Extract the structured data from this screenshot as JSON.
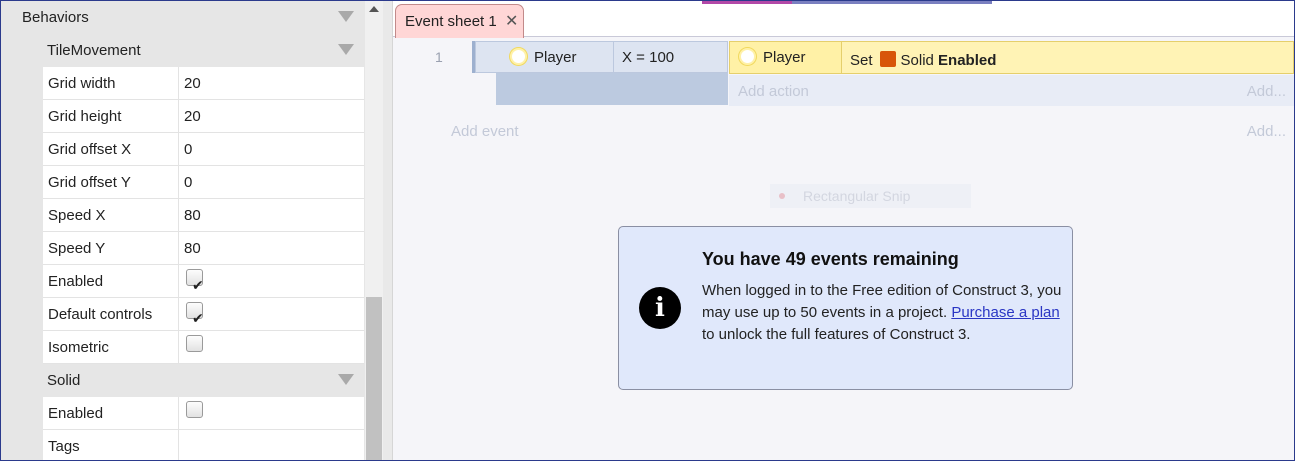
{
  "properties": {
    "behaviors_label": "Behaviors",
    "tile_movement": {
      "label": "TileMovement",
      "rows": [
        {
          "key": "Grid width",
          "value": "20"
        },
        {
          "key": "Grid height",
          "value": "20"
        },
        {
          "key": "Grid offset X",
          "value": "0"
        },
        {
          "key": "Grid offset Y",
          "value": "0"
        },
        {
          "key": "Speed X",
          "value": "80"
        },
        {
          "key": "Speed Y",
          "value": "80"
        }
      ],
      "checks": [
        {
          "key": "Enabled",
          "checked": true
        },
        {
          "key": "Default controls",
          "checked": true
        },
        {
          "key": "Isometric",
          "checked": false
        }
      ]
    },
    "solid": {
      "label": "Solid",
      "enabled_label": "Enabled",
      "enabled_checked": false,
      "tags_label": "Tags",
      "tags_value": ""
    },
    "check_glyph": "✔"
  },
  "sheet": {
    "tab_label": "Event sheet 1",
    "tab_close": "✕",
    "event_number": "1",
    "condition": {
      "object": "Player",
      "expression": "X = 100"
    },
    "action": {
      "object": "Player",
      "verb": "Set",
      "behavior": "Solid",
      "state": "Enabled"
    },
    "add_action": "Add action",
    "add_action_right": "Add...",
    "add_event": "Add event",
    "add_event_right": "Add...",
    "snip_label": "Rectangular Snip"
  },
  "notice": {
    "title": "You have 49 events remaining",
    "text1": "When logged in to the Free edition of Construct 3, you may use up to 50 events in a project.",
    "link": "Purchase a plan",
    "text2": "to unlock the full features of Construct 3.",
    "icon": "i"
  },
  "colors": {
    "condition_bg": "#dde4f1",
    "action_bg": "#fff3b5",
    "solid_icon": "#d8560a",
    "tab_bg": "#ffd6d6",
    "notice_bg": "#e0e8fb"
  }
}
